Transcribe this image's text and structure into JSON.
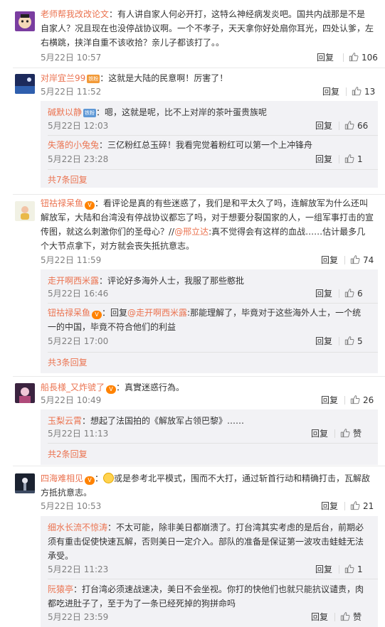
{
  "reply_label": "回复",
  "like_zan": "赞",
  "c1": {
    "user": "老师帮我改改论文",
    "text": "：有人讲自家人何必开打，这特么神经病发炎吧。国共内战那是不是自家人？况且现在也没停战协议啊。一个不孝子，天天拿你好处扇你耳光，四处认爹，左右横跳，挟洋自重不该收拾？亲儿子都该打了。。",
    "time": "5月22日 10:57",
    "likes": "106",
    "avatar_color": "#7a3da0"
  },
  "c2": {
    "user": "对岸宜兰99",
    "badge": "铁粉",
    "text": "：这就是大陆的民意啊！厉害了！",
    "time": "5月22日 11:52",
    "likes": "13",
    "avatar_color": "#1c2a5c",
    "replies": [
      {
        "user": "碱默以静",
        "badge": "铁粉",
        "text": "：嗯，这就是呢，比不上对岸的茶叶蛋贵族呢",
        "time": "5月22日 12:03",
        "likes": "66"
      },
      {
        "user": "失落的小兔兔",
        "text": "：三亿粉红总玉碎！我看完觉着粉红可以第一个上冲锋舟",
        "time": "5月22日 23:28",
        "likes": "1"
      }
    ],
    "more": "共7条回复"
  },
  "c3": {
    "user": "钮祜禄呆鱼",
    "text_a": "：看评论是真的有些迷惑了，我们是和平太久了吗，连解放军为什么还叫解放军，大陆和台湾没有停战协议都忘了吗，对于想要分裂国家的人，一组军事打击的宣传图，就这么刺激你们的圣母心？//",
    "mention": "@邢立达",
    "text_b": ":真不觉得会有这样的血战……估计最多几个大节点拿下，对方就会丧失抵抗意志。",
    "time": "5月22日 11:59",
    "likes": "74",
    "avatar_color": "#f1f1e4",
    "replies": [
      {
        "user": "走开啊西米露",
        "text": "：评论好多海外人士，我服了那些憨批",
        "time": "5月22日 16:46",
        "likes": "6"
      },
      {
        "user": "钮祜禄呆鱼",
        "text_a": "：回复",
        "mention": "@走开啊西米露",
        "text_b": ":那能理解了，毕竟对于这些海外人士，一个统一的中国，毕竟不符合他们的利益",
        "time": "5月22日 17:00",
        "likes": "5"
      }
    ],
    "more": "共3条回复"
  },
  "c4": {
    "user": "船長様_又炸號了",
    "text": "：真實迷惑行為。",
    "time": "5月22日 10:49",
    "likes": "26",
    "avatar_color": "#3b2340",
    "replies": [
      {
        "user": "玉梨云霄",
        "text": "：想起了法国拍的《解放军占领巴黎》……",
        "time": "5月22日 11:13"
      }
    ],
    "more": "共2条回复"
  },
  "c5": {
    "user": "四海难相见",
    "text": "或是参考北平模式，围而不大打，通过斩首行动和精确打击，瓦解敌方抵抗意志。",
    "time": "5月22日 10:53",
    "likes": "21",
    "avatar_color": "#1b2230",
    "replies": [
      {
        "user": "细水长流不惊涛",
        "text": "：不太可能，除非美日都崩溃了。打台湾其实考虑的是后台，前期必须有重击促使快速瓦解，否则美日一定介入。部队的准备是保证第一波攻击蛙蛙无法承受。",
        "time": "5月22日 11:23",
        "likes": "1"
      },
      {
        "user": "阮猿亭",
        "text": "：打台湾必须速战速决，美日不会坐视。你打的快他们也就只能抗议谴责，肉都吃进肚子了，至于为了一条已经死掉的狗拼命吗",
        "time": "5月22日 23:59"
      }
    ]
  }
}
